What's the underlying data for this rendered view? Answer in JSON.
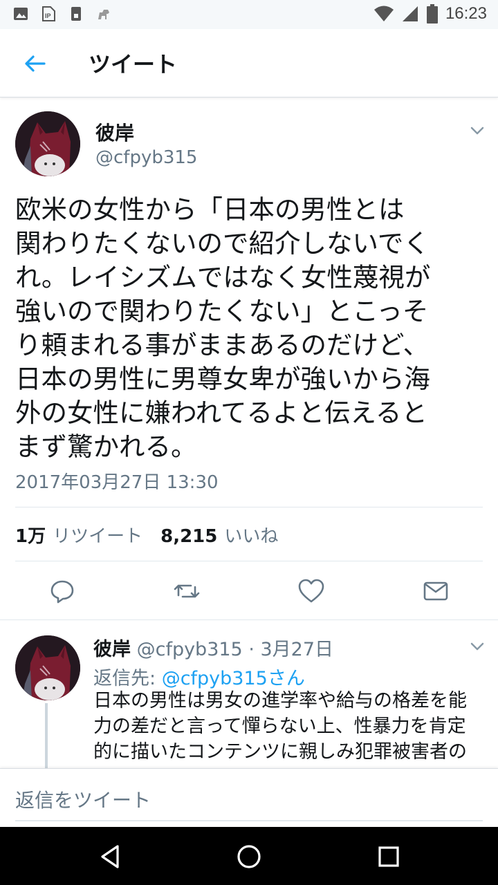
{
  "status_bar": {
    "time": "16:23",
    "icons": [
      "image-icon",
      "ip-icon",
      "sim-icon",
      "animal-icon",
      "wifi-icon",
      "signal-icon",
      "battery-icon"
    ]
  },
  "app_bar": {
    "title": "ツイート",
    "back_icon": "arrow-left-icon"
  },
  "tweet": {
    "display_name": "彼岸",
    "handle": "@cfpyb315",
    "text_lines": [
      "欧米の女性から「日本の男性とは",
      "関わりたくないので紹介しないでく",
      "れ。レイシズムではなく女性蔑視が",
      "強いので関わりたくない」とこっそ",
      "り頼まれる事がままあるのだけど、",
      "日本の男性に男尊女卑が強いから海",
      "外の女性に嫌われてるよと伝えると",
      "まず驚かれる。"
    ],
    "timestamp": "2017年03月27日 13:30",
    "retweet_count": "1万",
    "retweet_label": "リツイート",
    "like_count": "8,215",
    "like_label": "いいね",
    "actions": [
      "reply-icon",
      "retweet-icon",
      "like-icon",
      "message-icon"
    ]
  },
  "reply": {
    "display_name": "彼岸",
    "handle": "@cfpyb315",
    "separator": " · ",
    "date": "3月27日",
    "reply_to_prefix": "返信先: ",
    "reply_to_mention": "@cfpyb315さん",
    "text_lines": [
      "日本の男性は男女の進学率や給与の格差を能",
      "力の差だと言って憚らない上、性暴力を肯定",
      "的に描いたコンテンツに親しみ犯罪被害者の"
    ]
  },
  "compose": {
    "placeholder": "返信をツイート"
  },
  "colors": {
    "accent": "#1da1f2",
    "text_primary": "#14171a",
    "text_secondary": "#657786",
    "divider": "#e1e8ed"
  }
}
